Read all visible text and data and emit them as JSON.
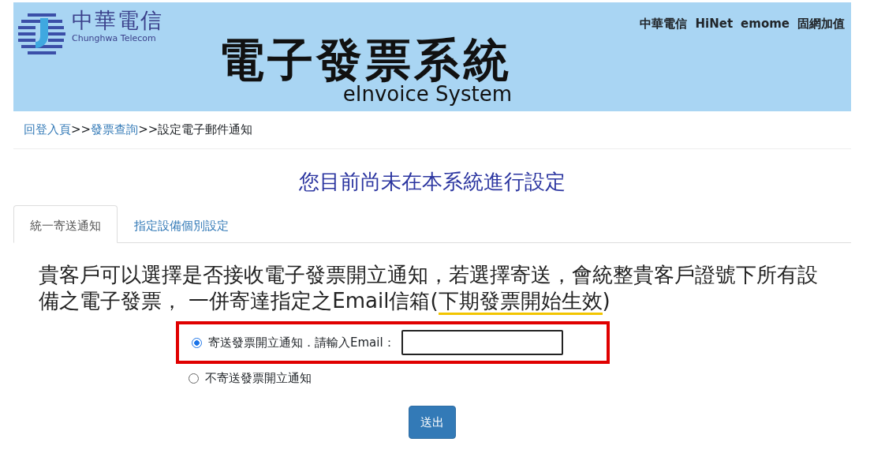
{
  "header": {
    "brand_cn": "中華電信",
    "brand_en": "Chunghwa Telecom",
    "title": "電子發票系統",
    "subtitle": "eInvoice System",
    "links": [
      "中華電信",
      "HiNet",
      "emome",
      "固網加值"
    ]
  },
  "breadcrumb": [
    {
      "label": "回登入頁",
      "link": true
    },
    {
      "label": ">>",
      "link": false
    },
    {
      "label": "發票查詢",
      "link": true
    },
    {
      "label": ">>",
      "link": false
    },
    {
      "label": "設定電子郵件通知",
      "link": false
    }
  ],
  "heading": "您目前尚未在本系統進行設定",
  "tabs": [
    {
      "label": "統一寄送通知",
      "selected": true
    },
    {
      "label": "指定設備個別設定",
      "selected": false
    }
  ],
  "notice": {
    "text": "貴客戶可以選擇是否接收電子發票開立通知，若選擇寄送，會統整貴客戶證號下所有設備之電子發票， 一併寄達指定之Email信箱(",
    "highlight": "下期發票開始生效",
    "end": ")"
  },
  "options": [
    {
      "label": "寄送發票開立通知．請輸入Email：",
      "selected": true,
      "kind": "email",
      "highlighted": true
    },
    {
      "label": "不寄送發票開立通知",
      "selected": false,
      "kind": "plain",
      "highlighted": false
    }
  ],
  "submit": "送出"
}
